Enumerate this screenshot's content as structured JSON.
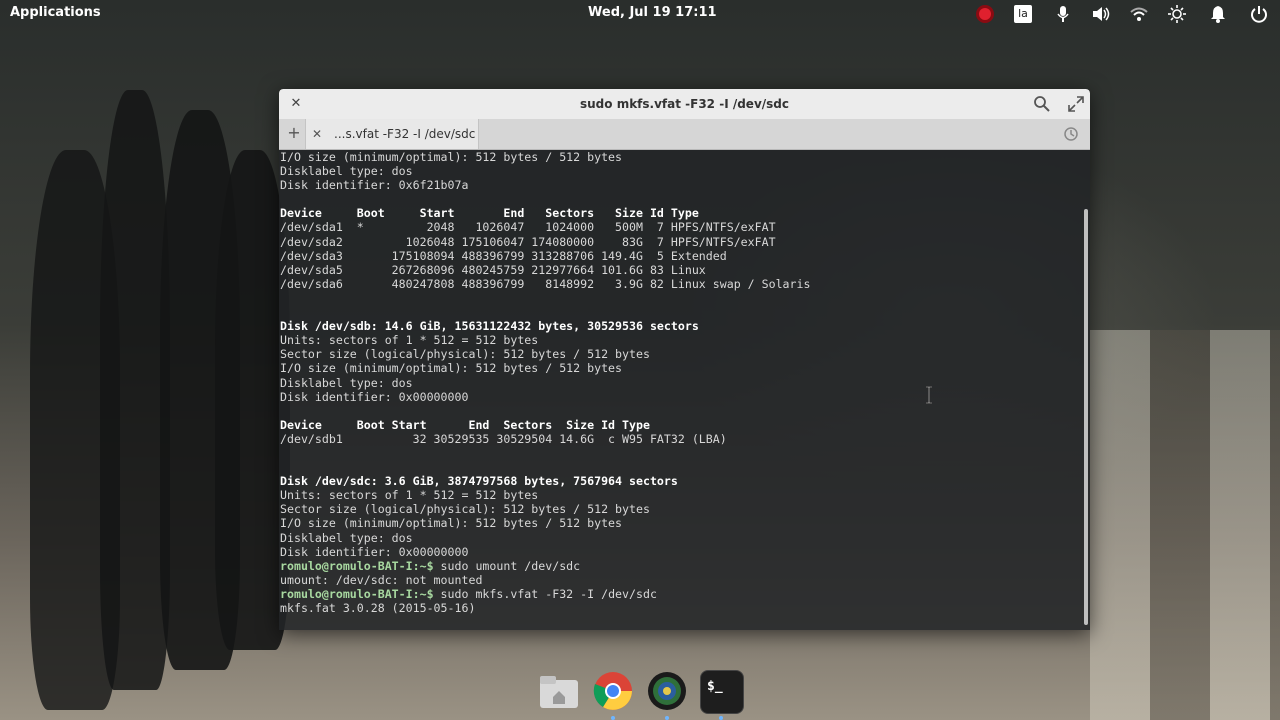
{
  "panel": {
    "applications_label": "Applications",
    "clock": "Wed, Jul 19   17:11",
    "tray_icons": [
      "record-icon",
      "keyboard-layout-icon",
      "microphone-icon",
      "volume-icon",
      "wifi-icon",
      "brightness-icon",
      "notifications-icon",
      "power-icon"
    ],
    "keyboard_layout": "la"
  },
  "window": {
    "title": "sudo mkfs.vfat -F32 -I /dev/sdc",
    "tab_label": "...s.vfat -F32 -I /dev/sdc"
  },
  "terminal": {
    "lines": [
      {
        "t": "I/O size (minimum/optimal): 512 bytes / 512 bytes",
        "s": ""
      },
      {
        "t": "Disklabel type: dos",
        "s": ""
      },
      {
        "t": "Disk identifier: 0x6f21b07a",
        "s": ""
      },
      {
        "t": "",
        "s": ""
      },
      {
        "t": "Device     Boot     Start       End   Sectors   Size Id Type",
        "s": "b"
      },
      {
        "t": "/dev/sda1  *         2048   1026047   1024000   500M  7 HPFS/NTFS/exFAT",
        "s": ""
      },
      {
        "t": "/dev/sda2         1026048 175106047 174080000    83G  7 HPFS/NTFS/exFAT",
        "s": ""
      },
      {
        "t": "/dev/sda3       175108094 488396799 313288706 149.4G  5 Extended",
        "s": ""
      },
      {
        "t": "/dev/sda5       267268096 480245759 212977664 101.6G 83 Linux",
        "s": ""
      },
      {
        "t": "/dev/sda6       480247808 488396799   8148992   3.9G 82 Linux swap / Solaris",
        "s": ""
      },
      {
        "t": "",
        "s": ""
      },
      {
        "t": "",
        "s": ""
      },
      {
        "t": "Disk /dev/sdb: 14.6 GiB, 15631122432 bytes, 30529536 sectors",
        "s": "b"
      },
      {
        "t": "Units: sectors of 1 * 512 = 512 bytes",
        "s": ""
      },
      {
        "t": "Sector size (logical/physical): 512 bytes / 512 bytes",
        "s": ""
      },
      {
        "t": "I/O size (minimum/optimal): 512 bytes / 512 bytes",
        "s": ""
      },
      {
        "t": "Disklabel type: dos",
        "s": ""
      },
      {
        "t": "Disk identifier: 0x00000000",
        "s": ""
      },
      {
        "t": "",
        "s": ""
      },
      {
        "t": "Device     Boot Start      End  Sectors  Size Id Type",
        "s": "b"
      },
      {
        "t": "/dev/sdb1          32 30529535 30529504 14.6G  c W95 FAT32 (LBA)",
        "s": ""
      },
      {
        "t": "",
        "s": ""
      },
      {
        "t": "",
        "s": ""
      },
      {
        "t": "Disk /dev/sdc: 3.6 GiB, 3874797568 bytes, 7567964 sectors",
        "s": "b"
      },
      {
        "t": "Units: sectors of 1 * 512 = 512 bytes",
        "s": ""
      },
      {
        "t": "Sector size (logical/physical): 512 bytes / 512 bytes",
        "s": ""
      },
      {
        "t": "I/O size (minimum/optimal): 512 bytes / 512 bytes",
        "s": ""
      },
      {
        "t": "Disklabel type: dos",
        "s": ""
      },
      {
        "t": "Disk identifier: 0x00000000",
        "s": ""
      },
      {
        "prompt": "romulo@romulo-BAT-I:~$",
        "t": " sudo umount /dev/sdc",
        "s": "p"
      },
      {
        "t": "umount: /dev/sdc: not mounted",
        "s": ""
      },
      {
        "prompt": "romulo@romulo-BAT-I:~$",
        "t": " sudo mkfs.vfat -F32 -I /dev/sdc",
        "s": "p"
      },
      {
        "t": "mkfs.fat 3.0.28 (2015-05-16)",
        "s": ""
      }
    ]
  },
  "dock": {
    "items": [
      "files-icon",
      "chrome-icon",
      "browser-icon",
      "terminal-icon"
    ],
    "terminal_glyph": "$_"
  }
}
